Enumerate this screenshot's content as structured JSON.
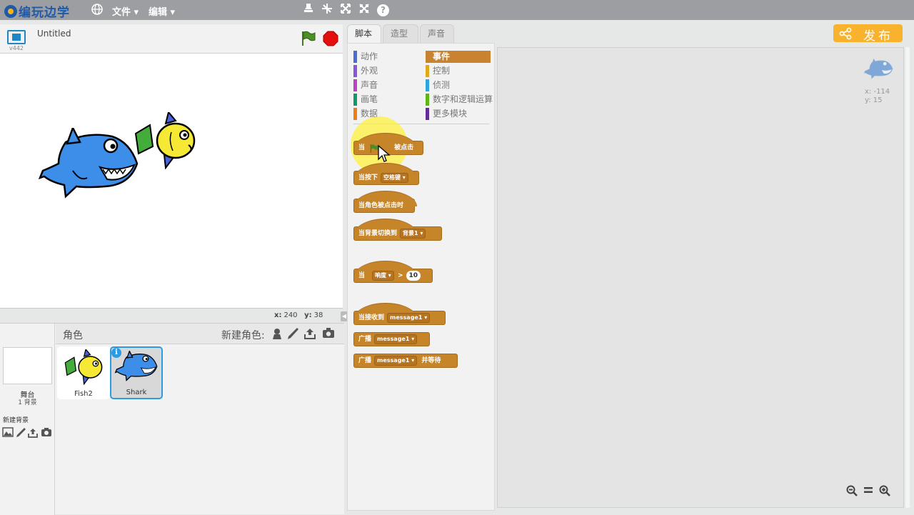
{
  "app": {
    "logo_text": "编玩边学",
    "menu_file": "文件",
    "menu_edit": "编辑"
  },
  "stage": {
    "project_title": "Untitled",
    "version": "v442",
    "mouse_x_label": "x:",
    "mouse_x": "240",
    "mouse_y_label": "y:",
    "mouse_y": "38"
  },
  "sprites_pane": {
    "header_label": "角色",
    "new_sprite_label": "新建角色:",
    "stage_label": "舞台",
    "backdrop_count": "1 背景",
    "new_backdrop_label": "新建背景",
    "sprites": [
      {
        "name": "Fish2",
        "selected": false
      },
      {
        "name": "Shark",
        "selected": true
      }
    ]
  },
  "tabs": [
    "脚本",
    "造型",
    "声音"
  ],
  "publish_label": "发布",
  "categories": {
    "left": [
      {
        "label": "动作",
        "color": "#4a6cd4"
      },
      {
        "label": "外观",
        "color": "#8a55d7"
      },
      {
        "label": "声音",
        "color": "#bb42c3"
      },
      {
        "label": "画笔",
        "color": "#0e9a6c"
      },
      {
        "label": "数据",
        "color": "#ee7d16"
      }
    ],
    "right": [
      {
        "label": "事件",
        "color": "#c88330",
        "active": true
      },
      {
        "label": "控制",
        "color": "#e1a91a"
      },
      {
        "label": "侦测",
        "color": "#2ca5e2"
      },
      {
        "label": "数字和逻辑运算",
        "color": "#5cb712"
      },
      {
        "label": "更多模块",
        "color": "#632d99"
      }
    ]
  },
  "blocks": {
    "when_flag_prefix": "当",
    "when_flag_suffix": "被点击",
    "when_key_label": "当按下",
    "when_key_dropdown": "空格键",
    "when_sprite_clicked": "当角色被点击时",
    "when_backdrop_label": "当背景切换到",
    "when_backdrop_dropdown": "背景1",
    "when_gt_prefix": "当",
    "when_gt_dropdown": "响度",
    "when_gt_op": ">",
    "when_gt_value": "10",
    "when_receive_label": "当接收到",
    "when_receive_dropdown": "message1",
    "broadcast_label": "广播",
    "broadcast_dropdown": "message1",
    "broadcast_wait_label": "广播",
    "broadcast_wait_dropdown": "message1",
    "broadcast_wait_suffix": "并等待"
  },
  "scripts_area": {
    "sprite_x": "x: -114",
    "sprite_y": "y: 15"
  }
}
